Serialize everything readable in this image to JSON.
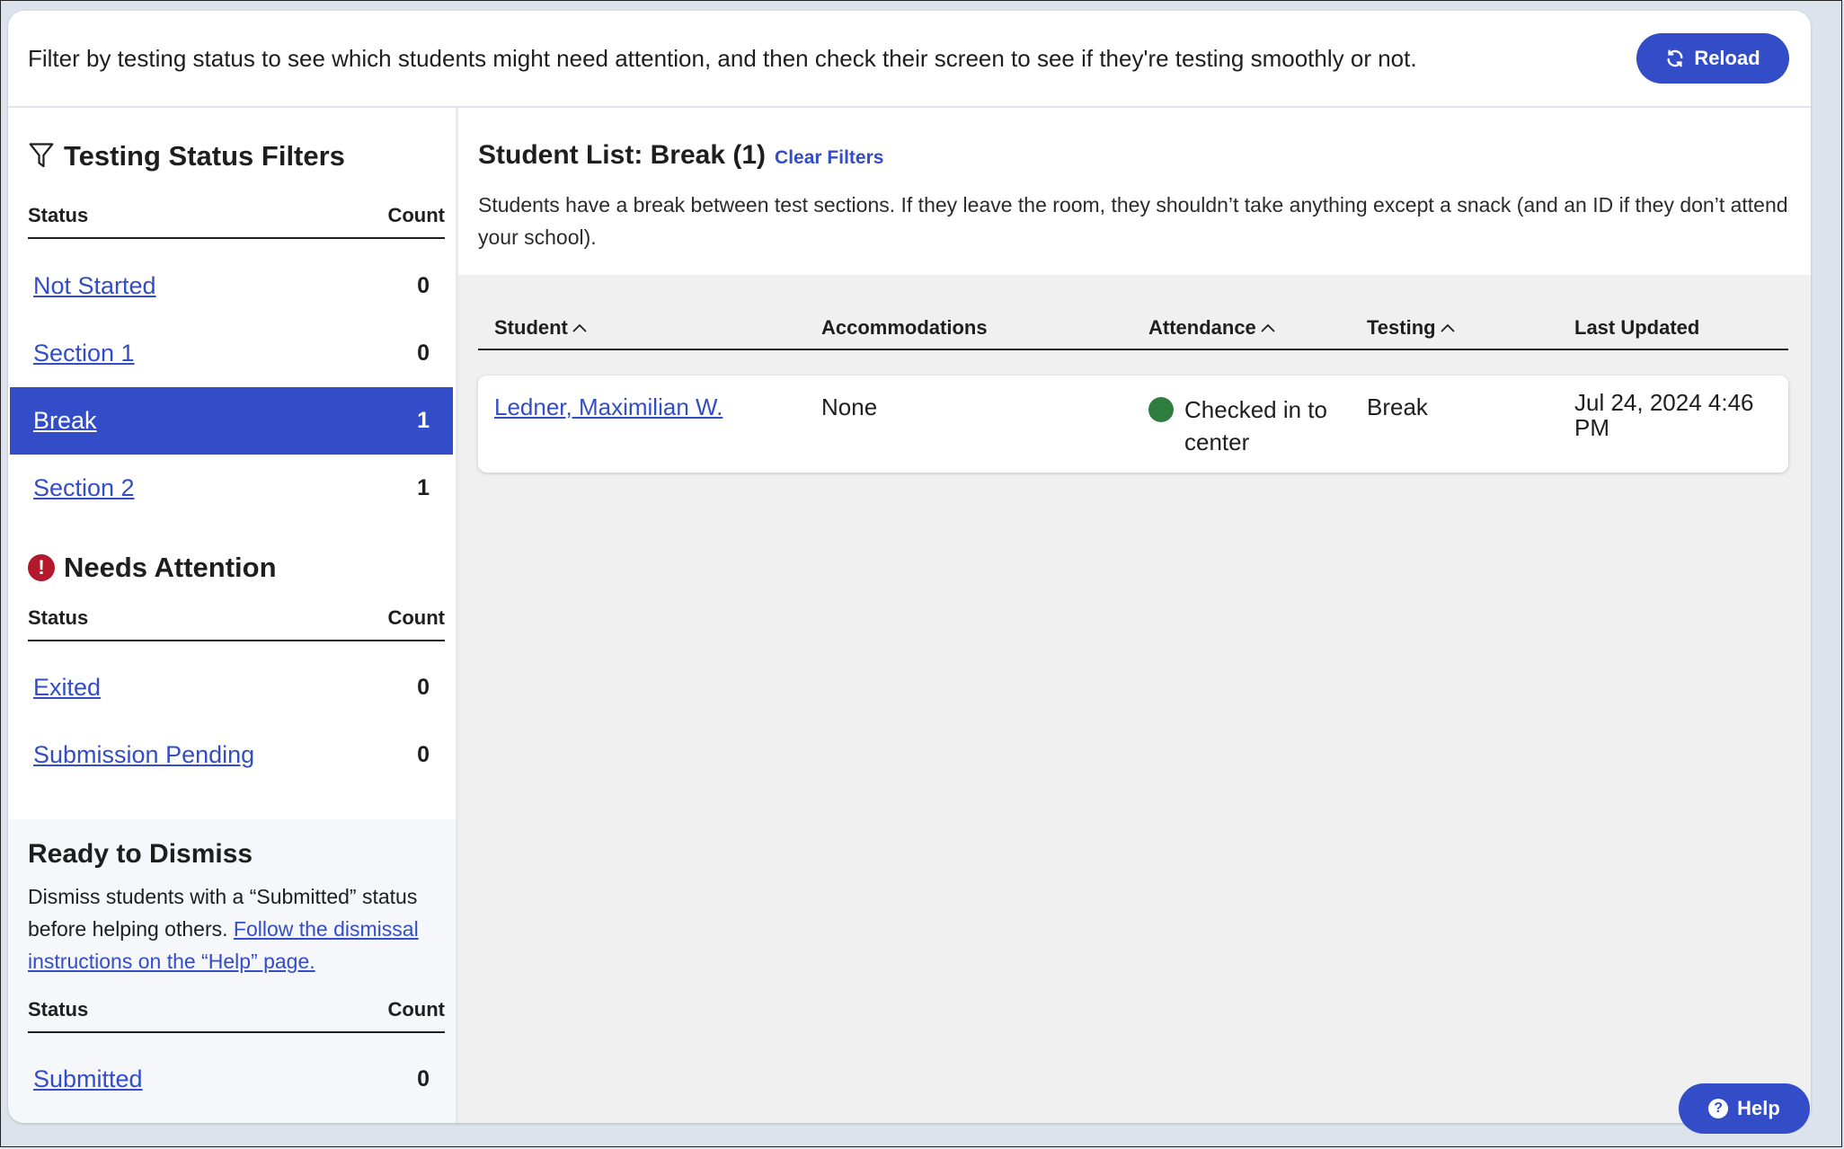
{
  "banner": {
    "text": "Filter by testing status to see which students might need attention, and then check their screen to see if they're testing smoothly or not.",
    "reload_label": "Reload"
  },
  "filters": {
    "title": "Testing Status Filters",
    "status_header": "Status",
    "count_header": "Count",
    "items": [
      {
        "label": "Not Started",
        "count": "0"
      },
      {
        "label": "Section 1",
        "count": "0"
      },
      {
        "label": "Break",
        "count": "1"
      },
      {
        "label": "Section 2",
        "count": "1"
      }
    ]
  },
  "attention": {
    "title": "Needs Attention",
    "status_header": "Status",
    "count_header": "Count",
    "items": [
      {
        "label": "Exited",
        "count": "0"
      },
      {
        "label": "Submission Pending",
        "count": "0"
      }
    ]
  },
  "dismiss": {
    "title": "Ready to Dismiss",
    "desc_text": "Dismiss students with a “Submitted” status before helping others. ",
    "desc_link": "Follow the dismissal instructions on the “Help” page.",
    "status_header": "Status",
    "count_header": "Count",
    "items": [
      {
        "label": "Submitted",
        "count": "0"
      }
    ]
  },
  "main": {
    "title": "Student List: Break (1)",
    "clear_filters": "Clear Filters",
    "description": "Students have a break between test sections. If they leave the room, they shouldn’t take anything except a snack (and an ID if they don’t attend your school).",
    "columns": {
      "student": "Student",
      "accommodations": "Accommodations",
      "attendance": "Attendance",
      "testing": "Testing",
      "last_updated": "Last Updated"
    },
    "rows": [
      {
        "student": "Ledner, Maximilian W.",
        "accommodations": "None",
        "attendance": "Checked in to center",
        "testing": "Break",
        "last_updated": "Jul 24, 2024 4:46 PM"
      }
    ]
  },
  "help_label": "Help",
  "colors": {
    "accent": "#324dc7",
    "checked_in": "#2e7d3e",
    "alert": "#b3192b"
  }
}
